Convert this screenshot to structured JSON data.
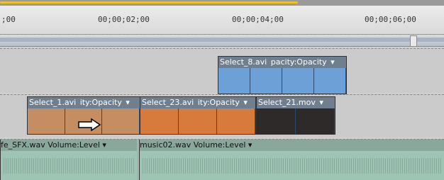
{
  "ruler": {
    "timecodes": [
      ";00",
      "00;00;02;00",
      "00;00;04;00",
      "00;00;06;00"
    ]
  },
  "tracks": {
    "video3": {
      "clips": [
        {
          "name": "Select_8.avi",
          "effect": "pacity:Opacity",
          "menu": "▾"
        }
      ]
    },
    "video2": {
      "clips": [
        {
          "name": "Select_1.avi",
          "effect": "ity:Opacity",
          "menu": "▾"
        },
        {
          "name": "Select_23.avi",
          "effect": "ity:Opacity",
          "menu": "▾"
        },
        {
          "name": "Select_21.mov",
          "effect": "",
          "menu": "▾"
        }
      ]
    },
    "audio": {
      "clips": [
        {
          "name": "fe_SFX.wav",
          "effect": "Volume:Level",
          "menu": "▾"
        },
        {
          "name": "music02.wav",
          "effect": "Volume:Level",
          "menu": "▾"
        }
      ]
    }
  },
  "colors": {
    "work_area": "#f1c21b",
    "video_clip_header": "#707f8f",
    "audio_clip": "#9ec4b4"
  },
  "icons": [
    "transition-arrow-icon",
    "work-area-handle-icon",
    "clip-menu-icon"
  ]
}
